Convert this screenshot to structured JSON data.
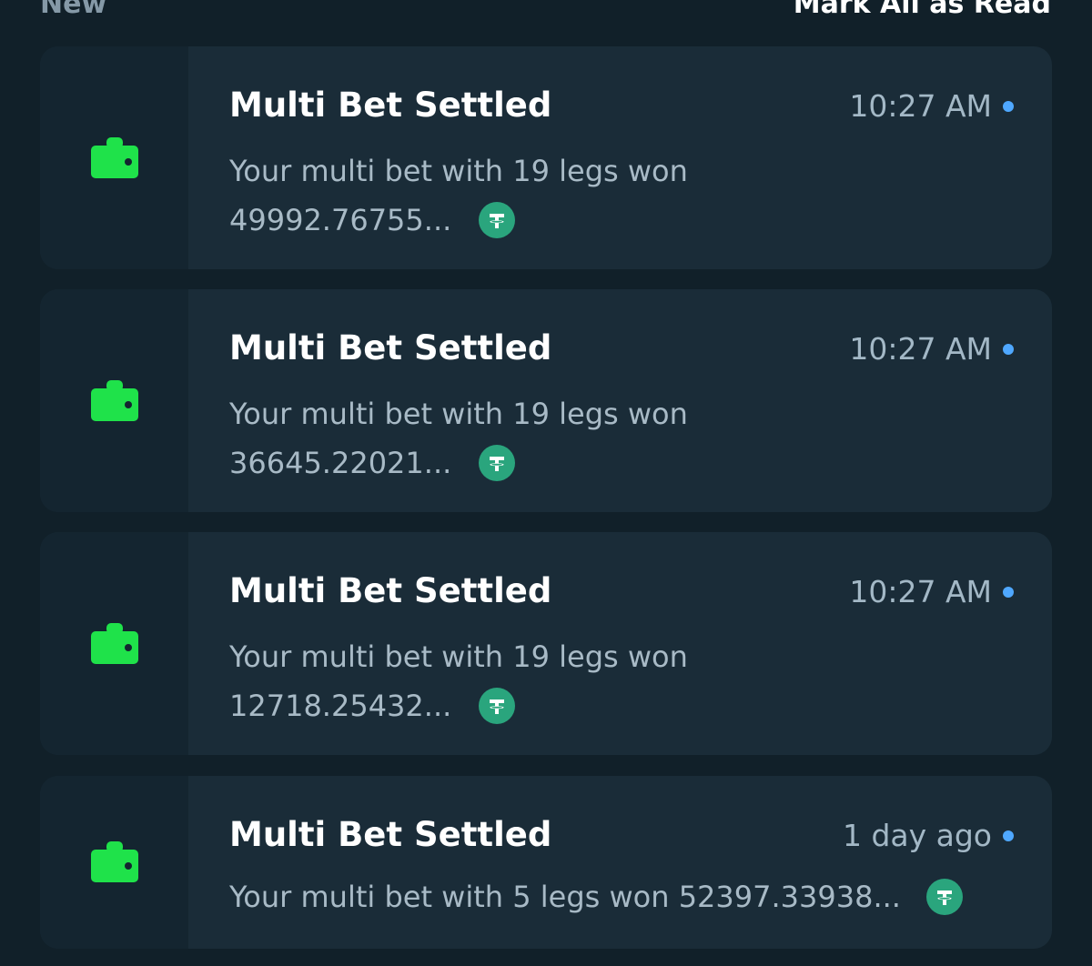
{
  "header": {
    "left_label": "New",
    "right_label": "Mark All as Read"
  },
  "notifications": [
    {
      "title": "Multi Bet Settled",
      "time": "10:27 AM",
      "message_line1": "Your multi bet with 19 legs won",
      "amount": "49992.76755...",
      "currency_icon": "tether-icon",
      "unread": true
    },
    {
      "title": "Multi Bet Settled",
      "time": "10:27 AM",
      "message_line1": "Your multi bet with 19 legs won",
      "amount": "36645.22021...",
      "currency_icon": "tether-icon",
      "unread": true
    },
    {
      "title": "Multi Bet Settled",
      "time": "10:27 AM",
      "message_line1": "Your multi bet with 19 legs won",
      "amount": "12718.25432...",
      "currency_icon": "tether-icon",
      "unread": true
    },
    {
      "title": "Multi Bet Settled",
      "time": "1 day ago",
      "message": "Your multi bet with 5 legs won 52397.33938...",
      "currency_icon": "tether-icon",
      "unread": true
    }
  ],
  "colors": {
    "background": "#112029",
    "card": "#1a2c38",
    "icon_green": "#1fe24a",
    "tether_green": "#2aa57d",
    "unread_dot": "#4fa8ff"
  }
}
